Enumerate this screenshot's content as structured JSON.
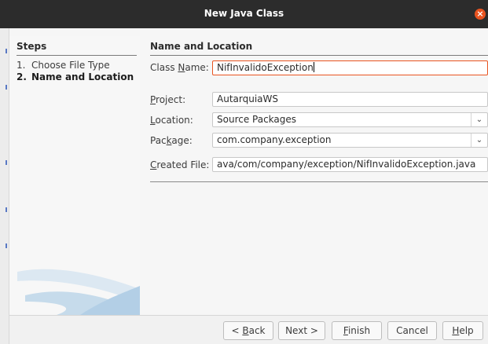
{
  "window": {
    "title": "New Java Class",
    "close_glyph": "×"
  },
  "steps": {
    "heading": "Steps",
    "items": [
      {
        "number": "1.",
        "label": "Choose File Type",
        "current": false
      },
      {
        "number": "2.",
        "label": "Name and Location",
        "current": true
      }
    ]
  },
  "panel": {
    "heading": "Name and Location",
    "class_name": {
      "label_pre": "Class ",
      "label_mnemonic": "N",
      "label_post": "ame:",
      "value": "NifInvalidoException"
    },
    "project": {
      "label_pre": "",
      "label_mnemonic": "P",
      "label_post": "roject:",
      "value": "AutarquiaWS"
    },
    "location": {
      "label_pre": "",
      "label_mnemonic": "L",
      "label_post": "ocation:",
      "value": "Source Packages"
    },
    "package": {
      "label_pre": "Pac",
      "label_mnemonic": "k",
      "label_post": "age:",
      "value": "com.company.exception"
    },
    "created_file": {
      "label_pre": "",
      "label_mnemonic": "C",
      "label_post": "reated File:",
      "value": "ava/com/company/exception/NifInvalidoException.java"
    }
  },
  "buttons": {
    "back": {
      "pre": "< ",
      "mnemonic": "B",
      "post": "ack"
    },
    "next": {
      "pre": "Next >",
      "mnemonic": "",
      "post": ""
    },
    "finish": {
      "pre": "",
      "mnemonic": "F",
      "post": "inish"
    },
    "cancel": {
      "pre": "Cancel",
      "mnemonic": "",
      "post": ""
    },
    "help": {
      "pre": "",
      "mnemonic": "H",
      "post": "elp"
    }
  },
  "icons": {
    "close": "close-icon",
    "dropdown": "chevron-down-icon"
  },
  "colors": {
    "accent": "#e95420",
    "titlebar": "#2c2c2c",
    "background": "#f6f6f6"
  }
}
